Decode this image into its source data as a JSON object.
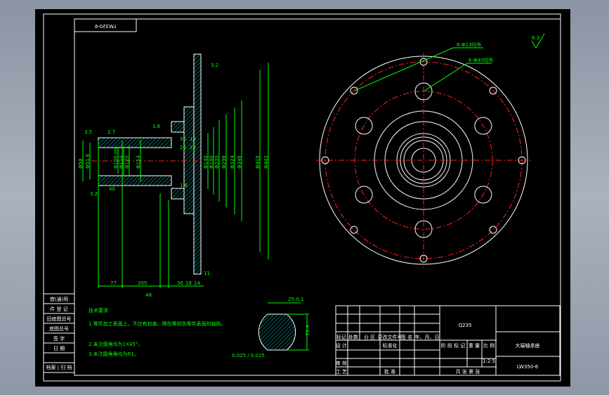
{
  "drawing": {
    "mirrored_code": "LW350-6",
    "material": "Q235",
    "part_name": "大端轴承座",
    "drawing_no": "LW350-6",
    "scale": "1:2.5",
    "title_block_labels": [
      "标记",
      "处数",
      "分 区",
      "更改文件号",
      "签 名",
      "年、月、日",
      "设 计",
      "标准化",
      "审 核",
      "工 艺",
      "批 准",
      "阶 段 标 记",
      "重 量",
      "比 例",
      "共 张 第 张"
    ],
    "left_strip_labels": [
      "借(通)用",
      "件 登 记",
      "旧底图总号",
      "底图总号",
      "签 字",
      "日 期",
      "档案 | 归 档"
    ]
  },
  "notes": {
    "title": "技术要求",
    "items": [
      "1.零件加工表面上，不应有划痕、擦伤等损伤零件表面的缺陷。",
      "2.未注倒角均为1X45°。",
      "3.未注圆角角均为R1。"
    ]
  },
  "annotations": {
    "holes_small": "8-Φ13均布",
    "holes_large": "6-Φ40均布",
    "roughness_top": "6.3",
    "roughness_a": "3.2",
    "roughness_b": "1.6",
    "roughness_c": "1.6",
    "roughness_d": "3.2",
    "section_width": "25-0.1",
    "section_height": "73.4",
    "section_tol": "0.025 / 0.025",
    "dims_horizontal": [
      "3.5",
      "2.7",
      "40",
      "48",
      "77",
      "205",
      "36",
      "18",
      "14",
      "11",
      "36",
      "18",
      "26",
      "23"
    ],
    "dims_diameter": [
      "Φ58",
      "Φ51.6",
      "Φ100 H7",
      "Φ110",
      "Φ120",
      "Φ114",
      "Φ140",
      "Φ180",
      "Φ230",
      "Φ298",
      "Φ324",
      "Φ346",
      "Φ415",
      "Φ442"
    ]
  },
  "colors": {
    "sheet": "#000000",
    "lines": "#ffffff",
    "dims": "#00ff00",
    "centerline": "#ff2020",
    "hatch": "#00c8c8"
  }
}
